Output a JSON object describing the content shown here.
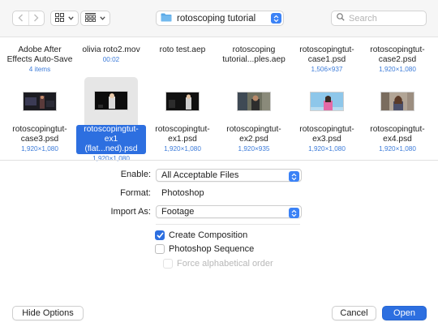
{
  "toolbar": {
    "back_icon": "chevron-left-icon",
    "forward_icon": "chevron-right-icon",
    "view_icon": "grid-view-icon",
    "group_icon": "group-grid-icon",
    "location": "rotoscoping tutorial",
    "search_placeholder": "Search"
  },
  "files": [
    {
      "name": "Adobe After Effects Auto-Save",
      "meta": "4 items",
      "kind": "folder"
    },
    {
      "name": "olivia roto2.mov",
      "meta": "00:02",
      "kind": "file"
    },
    {
      "name": "roto test.aep",
      "meta": "",
      "kind": "file"
    },
    {
      "name": "rotoscoping tutorial...ples.aep",
      "meta": "",
      "kind": "file"
    },
    {
      "name": "rotoscopingtut-case1.psd",
      "meta": "1,506×937",
      "kind": "file"
    },
    {
      "name": "rotoscopingtut-case2.psd",
      "meta": "1,920×1,080",
      "kind": "file"
    },
    {
      "name": "rotoscopingtut-case3.psd",
      "meta": "1,920×1,080",
      "kind": "image"
    },
    {
      "name": "rotoscopingtut-ex1 (flat...ned).psd",
      "meta": "1,920×1,080",
      "kind": "image",
      "selected": true
    },
    {
      "name": "rotoscopingtut-ex1.psd",
      "meta": "1,920×1,080",
      "kind": "image"
    },
    {
      "name": "rotoscopingtut-ex2.psd",
      "meta": "1,920×935",
      "kind": "image"
    },
    {
      "name": "rotoscopingtut-ex3.psd",
      "meta": "1,920×1,080",
      "kind": "image"
    },
    {
      "name": "rotoscopingtut-ex4.psd",
      "meta": "1,920×1,080",
      "kind": "image"
    }
  ],
  "options": {
    "enable_label": "Enable:",
    "enable_value": "All Acceptable Files",
    "format_label": "Format:",
    "format_value": "Photoshop",
    "import_label": "Import As:",
    "import_value": "Footage",
    "create_composition": {
      "label": "Create Composition",
      "checked": true
    },
    "photoshop_sequence": {
      "label": "Photoshop Sequence",
      "checked": false
    },
    "force_alpha": {
      "label": "Force alphabetical order",
      "checked": false,
      "enabled": false
    }
  },
  "buttons": {
    "hide_options": "Hide Options",
    "cancel": "Cancel",
    "open": "Open"
  },
  "colors": {
    "accent": "#2d6fe0",
    "folder": "#5aa9e6"
  }
}
